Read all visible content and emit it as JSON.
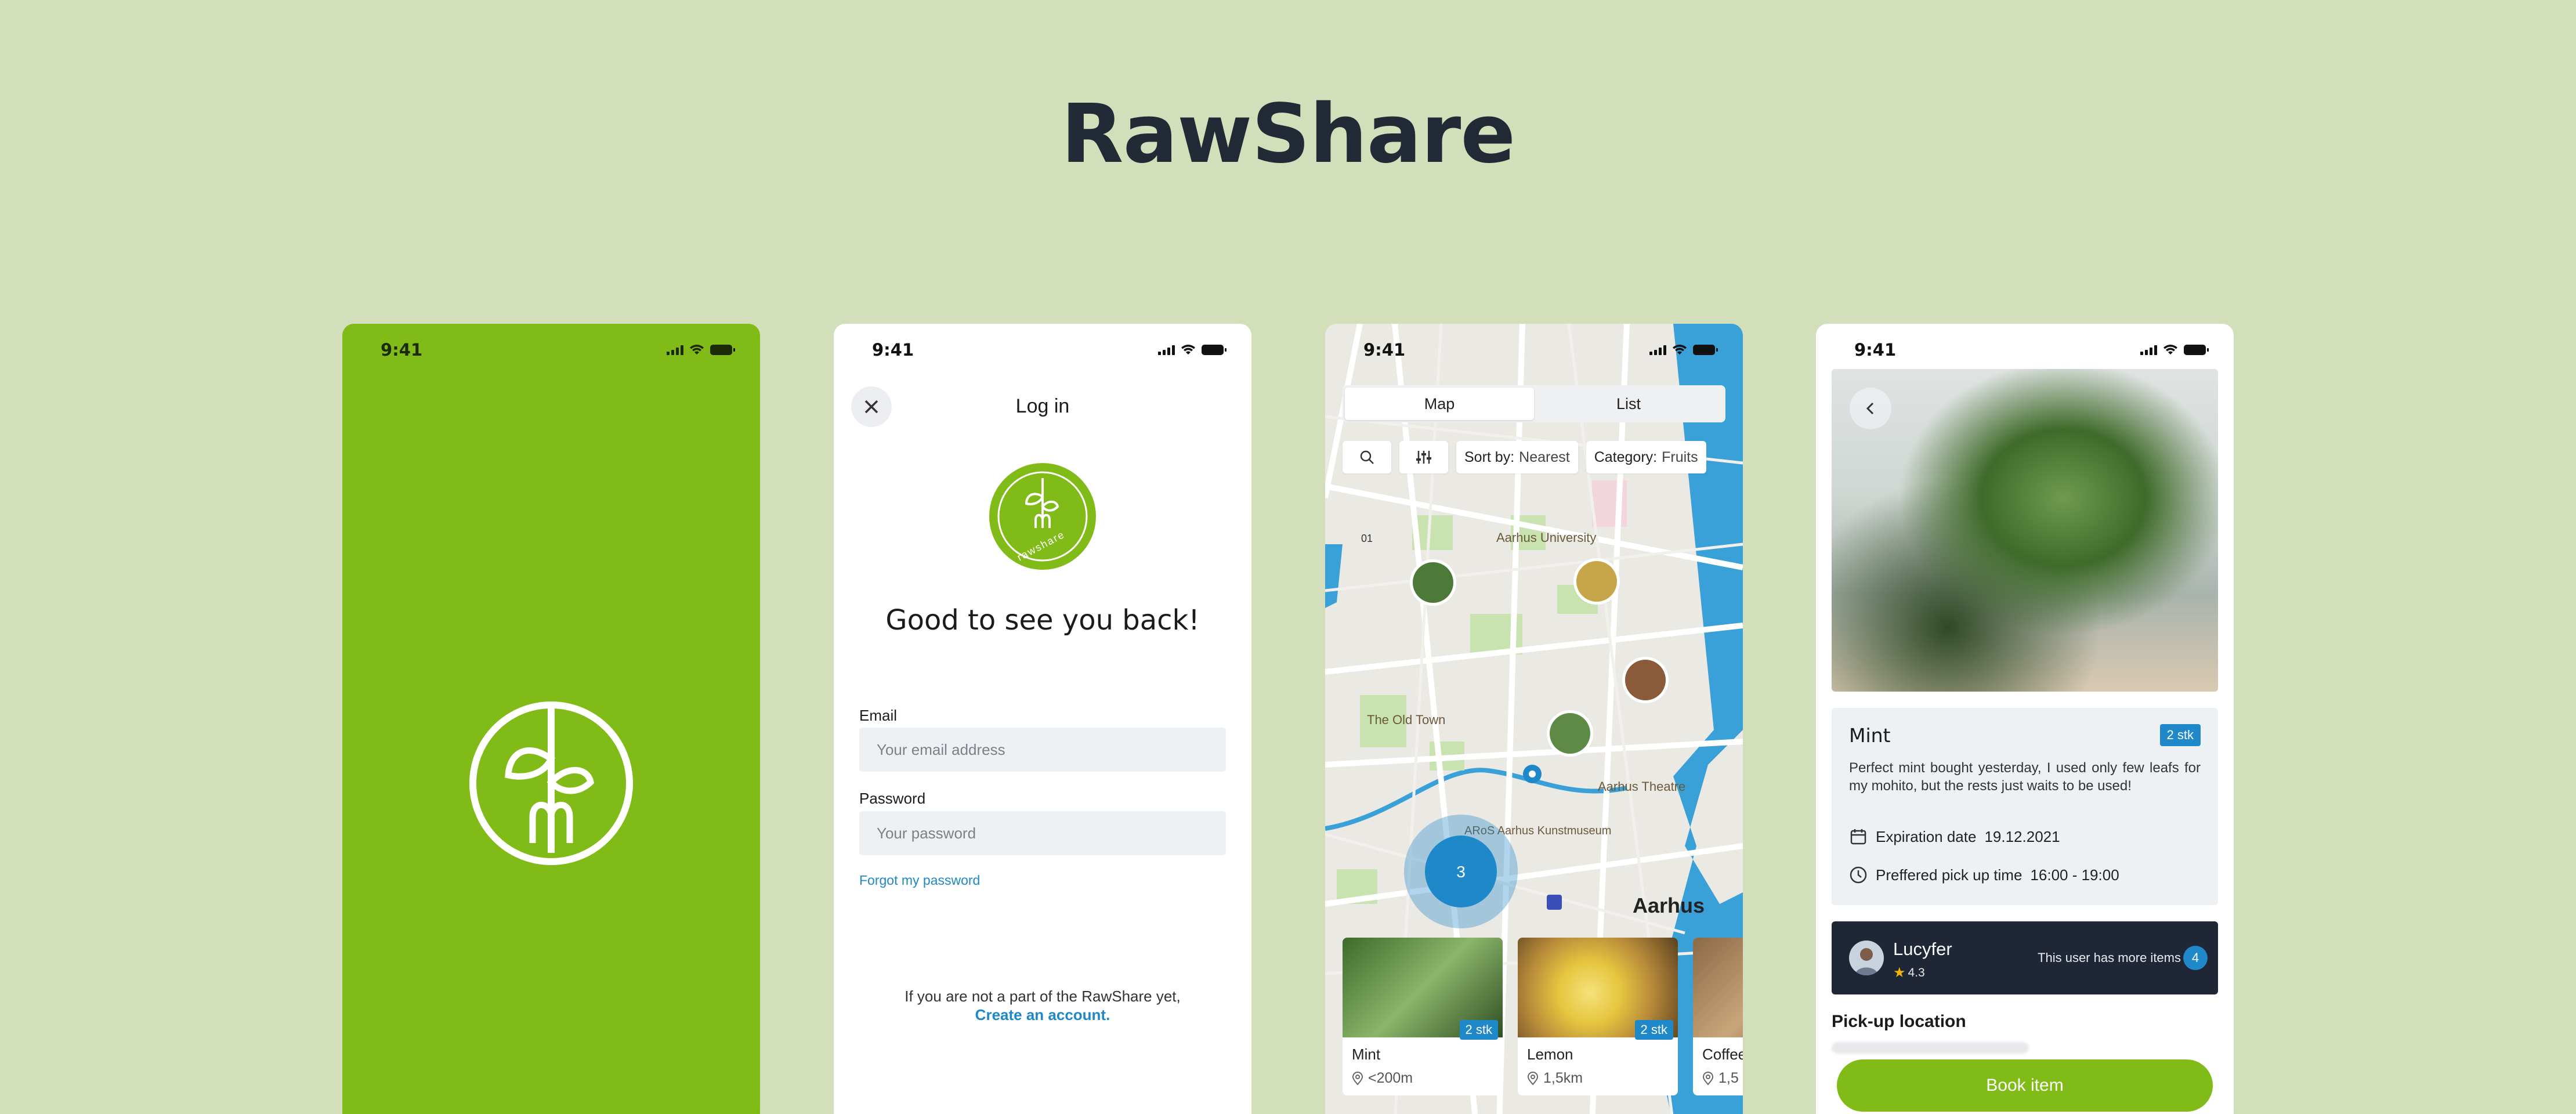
{
  "page": {
    "title": "RawShare"
  },
  "status": {
    "time": "9:41"
  },
  "splash": {
    "brand_color": "#80bb17"
  },
  "login": {
    "header": "Log in",
    "logo_text": "rawshare",
    "greeting": "Good to see you back!",
    "email_label": "Email",
    "email_placeholder": "Your email address",
    "password_label": "Password",
    "password_placeholder": "Your password",
    "forgot_link": "Forgot my password",
    "footer_text": "If you are not a part of the RawShare yet,",
    "create_link": "Create an account."
  },
  "map": {
    "tabs": [
      "Map",
      "List"
    ],
    "active_tab": "Map",
    "sort_label": "Sort by:",
    "sort_value": "Nearest",
    "category_label": "Category:",
    "category_value": "Fruits",
    "place_labels": [
      "Aarhus University",
      "The Old Town",
      "Aarhus Theatre",
      "ARoS Aarhus Kunstmuseum",
      "Aarhus",
      "01"
    ],
    "cluster_count": "3",
    "cards": [
      {
        "name": "Mint",
        "badge": "2 stk",
        "distance": "<200m"
      },
      {
        "name": "Lemon",
        "badge": "2 stk",
        "distance": "1,5km"
      },
      {
        "name": "Coffee",
        "badge": "",
        "distance": "1,5"
      }
    ]
  },
  "detail": {
    "title": "Mint",
    "badge": "2 stk",
    "description": "Perfect mint bought yesterday, I used only few leafs for my mohito, but the rests just waits to be used!",
    "expiration_label": "Expiration date",
    "expiration_value": "19.12.2021",
    "pickup_label": "Preffered pick up time",
    "pickup_value": "16:00 - 19:00",
    "user_name": "Lucyfer",
    "user_rating": "4.3",
    "more_items_text": "This user has more items",
    "more_items_count": "4",
    "pickup_location_label": "Pick-up location",
    "book_button": "Book item"
  },
  "colors": {
    "background": "#d3dfbb",
    "green": "#80bb17",
    "blue": "#1e88c9",
    "dark": "#1f2635"
  }
}
